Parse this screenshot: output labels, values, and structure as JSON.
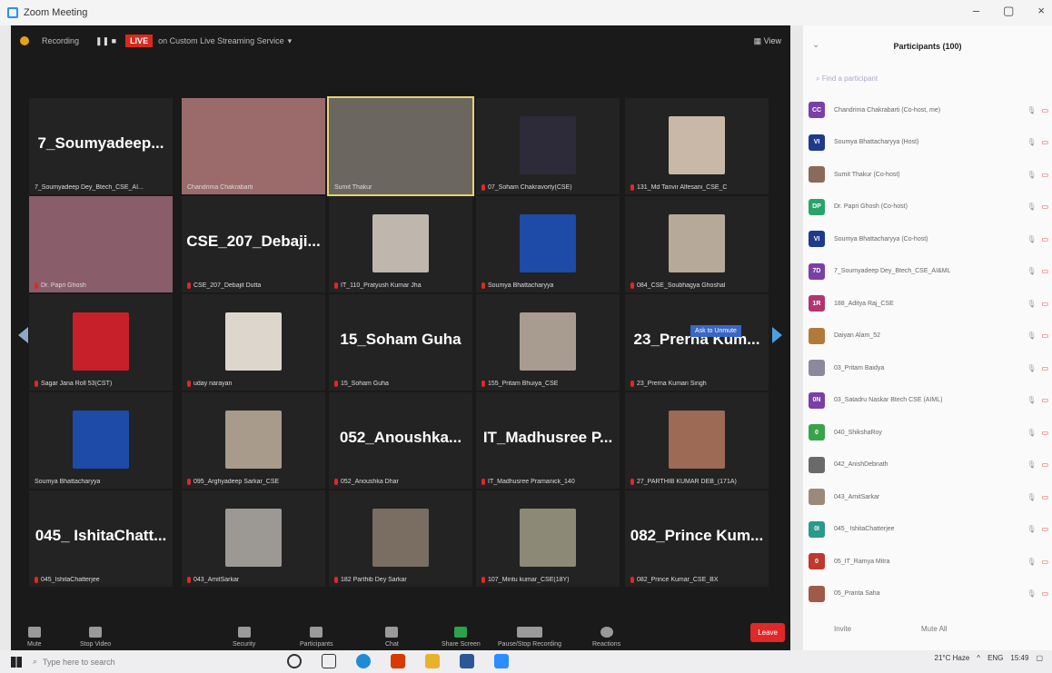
{
  "window": {
    "title": "Zoom Meeting",
    "controls": [
      "–",
      "▢",
      "×"
    ]
  },
  "topbar": {
    "recording": "Recording",
    "live": "LIVE",
    "streaming": "on Custom Live Streaming Service",
    "view": "View"
  },
  "tiles": [
    {
      "big": "7_Soumyadeep...",
      "name": "7_Soumyadeep Dey_Btech_CSE_AI...",
      "muted": false
    },
    {
      "big": "",
      "name": "Chandrima Chakrabarti",
      "muted": false,
      "video": "#9b6a6a"
    },
    {
      "big": "",
      "name": "Sumit Thakur",
      "muted": false,
      "video": "#6b6660",
      "active": true
    },
    {
      "big": "",
      "name": "07_Soham Chakravorty(CSE)",
      "muted": true,
      "avatar": "#2d2a3a"
    },
    {
      "big": "",
      "name": "131_Md Tanvir Alfesani_CSE_C",
      "muted": true,
      "avatar": "#c9b8a8"
    },
    {
      "big": "",
      "name": "Dr. Papri Ghosh",
      "muted": true,
      "video": "#8a5d6a"
    },
    {
      "big": "CSE_207_Debaji...",
      "name": "CSE_207_Debajit Dutta",
      "muted": true
    },
    {
      "big": "",
      "name": "IT_110_Pratyush Kumar Jha",
      "muted": true,
      "avatar": "#bfb7ae"
    },
    {
      "big": "",
      "name": "Soumya Bhattacharyya",
      "muted": true,
      "avatar": "#1e4aa8"
    },
    {
      "big": "",
      "name": "084_CSE_Soubhagya Ghoshal",
      "muted": true,
      "avatar": "#b7a99a"
    },
    {
      "big": "",
      "name": "Sagar Jana Roll 53(CST)",
      "muted": true,
      "avatar": "#c8202a"
    },
    {
      "big": "",
      "name": "uday narayan",
      "muted": true,
      "avatar": "#ddd6cc"
    },
    {
      "big": "15_Soham Guha",
      "name": "15_Soham Guha",
      "muted": true
    },
    {
      "big": "",
      "name": "155_Pritam Bhuiya_CSE",
      "muted": true,
      "avatar": "#a79c8f"
    },
    {
      "big": "23_Prerna Kum...",
      "name": "23_Prerna Kumari Singh",
      "muted": true
    },
    {
      "big": "",
      "name": "Soumya Bhattacharyya",
      "muted": false,
      "avatar": "#1e4aa8"
    },
    {
      "big": "",
      "name": "095_Arghyadeep Sarkar_CSE",
      "muted": true,
      "avatar": "#a89b8c"
    },
    {
      "big": "052_Anoushka...",
      "name": "052_Anoushka Dhar",
      "muted": true
    },
    {
      "big": "IT_Madhusree P...",
      "name": "IT_Madhusree Pramanick_140",
      "muted": true
    },
    {
      "big": "",
      "name": "27_PARTHIB KUMAR DEB_(171A)",
      "muted": true,
      "avatar": "#9c6a55"
    },
    {
      "big": "045_ IshitaChatt...",
      "name": "045_IshitaChatterjee",
      "muted": true
    },
    {
      "big": "",
      "name": "043_AmitSarkar",
      "muted": true,
      "avatar": "#9c9894"
    },
    {
      "big": "",
      "name": "182 Parthib Dey Sarkar",
      "muted": true,
      "avatar": "#7a6e62"
    },
    {
      "big": "",
      "name": "107_Mintu kumar_CSE(18Y)",
      "muted": true,
      "avatar": "#8c8a77"
    },
    {
      "big": "082_Prince Kum...",
      "name": "082_Prince Kumar_CSE_BX",
      "muted": true
    }
  ],
  "ask_unmute": "Ask to Unmute",
  "toolbar": [
    {
      "label": "Mute"
    },
    {
      "label": "Stop Video"
    },
    {
      "label": "Security"
    },
    {
      "label": "Participants",
      "count": "100"
    },
    {
      "label": "Chat"
    },
    {
      "label": "Share Screen"
    },
    {
      "label": "Pause/Stop Recording"
    },
    {
      "label": "Reactions"
    }
  ],
  "leave": "Leave",
  "panel": {
    "title": "Participants (100)",
    "search_placeholder": "Find a participant",
    "participants": [
      {
        "initials": "CC",
        "color": "#7b3fa6",
        "name": "Chandrima Chakrabarti (Co-host, me)"
      },
      {
        "initials": "VI",
        "color": "#1e3a8a",
        "name": "Soumya Bhattacharyya (Host)"
      },
      {
        "initials": "",
        "color": "#8a6a5a",
        "name": "Sumit Thakur (Co-host)"
      },
      {
        "initials": "DP",
        "color": "#2aa36b",
        "name": "Dr. Papri Ghosh (Co-host)"
      },
      {
        "initials": "VI",
        "color": "#1e3a8a",
        "name": "Soumya Bhattacharyya (Co-host)"
      },
      {
        "initials": "7D",
        "color": "#7b3fa6",
        "name": "7_Soumyadeep Dey_Btech_CSE_AI&ML"
      },
      {
        "initials": "1R",
        "color": "#b0366f",
        "name": "188_Aditya Raj_CSE"
      },
      {
        "initials": "",
        "color": "#b07a3a",
        "name": "Daiyan Alam_52"
      },
      {
        "initials": "",
        "color": "#8a8a9a",
        "name": "03_Pritam Baidya"
      },
      {
        "initials": "0N",
        "color": "#7b3fa6",
        "name": "03_Satadru Naskar Btech CSE (AIML)"
      },
      {
        "initials": "0",
        "color": "#3aa34a",
        "name": "040_ShikshaRoy"
      },
      {
        "initials": "",
        "color": "#6a6a6a",
        "name": "042_AnishDebnath"
      },
      {
        "initials": "",
        "color": "#9a8a7a",
        "name": "043_AmitSarkar"
      },
      {
        "initials": "0I",
        "color": "#2a9a8a",
        "name": "045_ IshitaChatterjee"
      },
      {
        "initials": "0",
        "color": "#c0392b",
        "name": "05_IT_Ramya Mitra"
      },
      {
        "initials": "",
        "color": "#a05a4a",
        "name": "05_Pranta Saha"
      }
    ],
    "invite": "Invite",
    "mute_all": "Mute All"
  },
  "taskbar": {
    "search": "Type here to search",
    "weather": "21°C  Haze",
    "lang": "ENG",
    "time": "15:49"
  }
}
